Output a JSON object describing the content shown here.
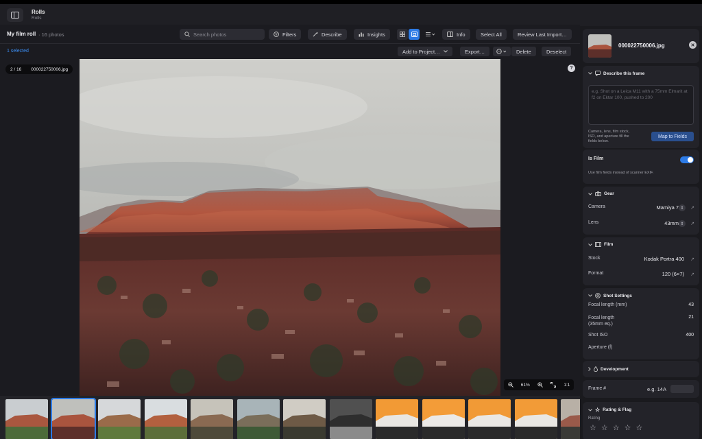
{
  "titlebar": {
    "title": "Rolls",
    "subtitle": "Rolls"
  },
  "toolbar": {
    "roll_title": "My film roll",
    "photo_count": "· 16 photos",
    "search_placeholder": "Search photos",
    "filters_label": "Filters",
    "describe_label": "Describe",
    "insights_label": "Insights",
    "info_label": "Info",
    "select_all_label": "Select All",
    "review_label": "Review Last Import…"
  },
  "selection": {
    "selected_text": "1 selected",
    "add_to_project_label": "Add to Project…",
    "export_label": "Export…",
    "delete_label": "Delete",
    "deselect_label": "Deselect"
  },
  "viewer": {
    "counter": "2 / 16",
    "filename": "000022750006.jpg",
    "help_symbol": "?",
    "zoom_level": "61%",
    "one_to_one": "1:1"
  },
  "filmstrip": {
    "thumb_count": 13,
    "selected_index": 1
  },
  "inspector": {
    "filename": "000022750006.jpg",
    "close_symbol": "✕",
    "describe": {
      "title": "Describe this frame",
      "placeholder": "e.g. Shot on a Leica M11 with a 75mm Elmarit at f2 on Ektar 100, pushed to 200",
      "hint_line1": "Camera, lens, film stock,",
      "hint_line2": "ISO, and aperture fill the",
      "hint_line3": "fields below.",
      "map_button": "Map to Fields"
    },
    "is_film": {
      "label": "Is Film",
      "hint": "Use film fields instead of scanner EXIF.",
      "enabled": true
    },
    "gear": {
      "title": "Gear",
      "camera_label": "Camera",
      "camera_value": "Mamiya 7",
      "lens_label": "Lens",
      "lens_value": "43mm"
    },
    "film": {
      "title": "Film",
      "stock_label": "Stock",
      "stock_value": "Kodak Portra 400",
      "format_label": "Format",
      "format_value": "120 (6×7)"
    },
    "shot": {
      "title": "Shot Settings",
      "focal_label": "Focal length (mm)",
      "focal_value": "43",
      "focal35_label1": "Focal length",
      "focal35_label2": "(35mm eq.)",
      "focal35_value": "21",
      "iso_label": "Shot ISO",
      "iso_value": "400",
      "aperture_label": "Aperture (f)"
    },
    "development": {
      "title": "Development"
    },
    "frame": {
      "label": "Frame #",
      "placeholder": "e.g. 14A"
    },
    "rating": {
      "title": "Rating & Flag",
      "label": "Rating",
      "stars": 0
    }
  },
  "colors": {
    "accent": "#2d7be6",
    "map_button": "#2a4f8e"
  }
}
